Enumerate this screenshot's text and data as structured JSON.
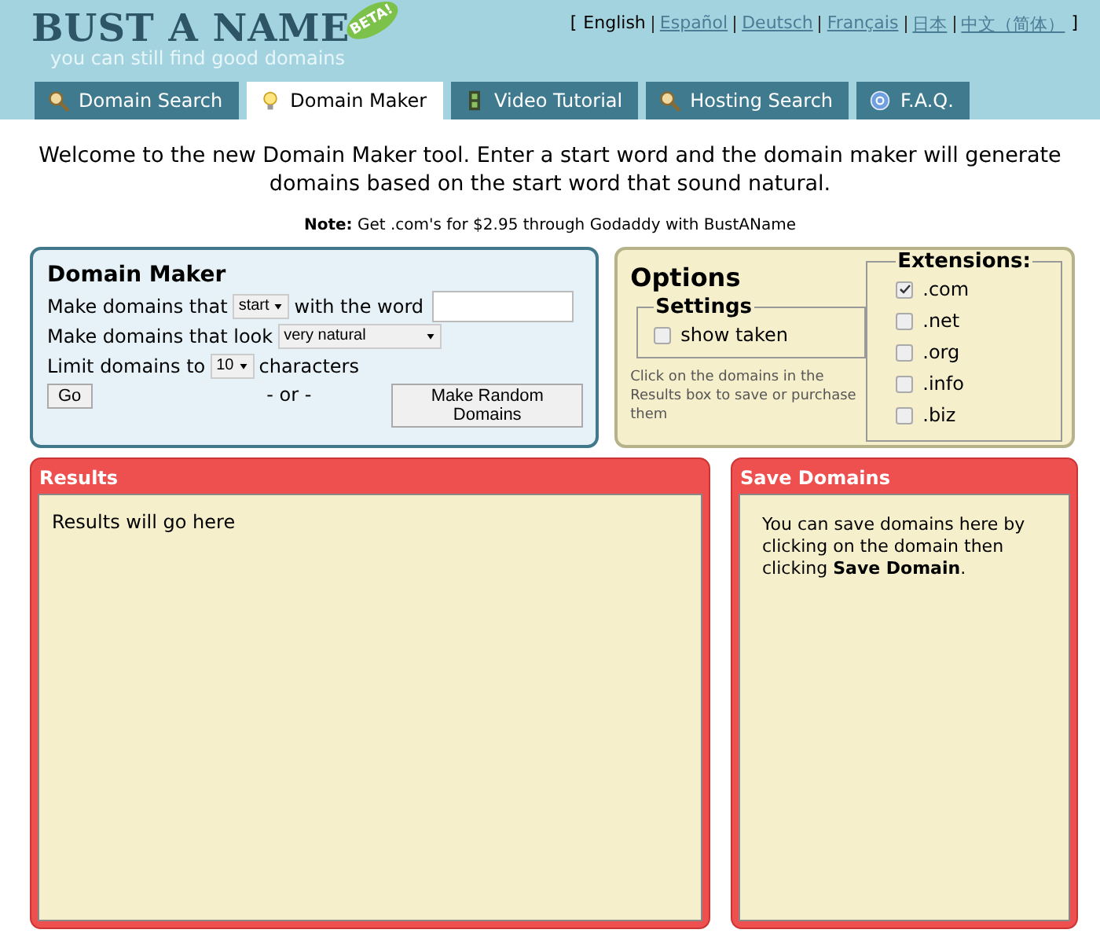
{
  "logo": {
    "title": "BUST A NAME",
    "badge": "BETA!",
    "tagline": "you can still find good domains"
  },
  "language_brackets": {
    "open": "[",
    "close": "]"
  },
  "languages": [
    {
      "label": "English",
      "selected": true
    },
    {
      "label": "Español",
      "selected": false
    },
    {
      "label": "Deutsch",
      "selected": false
    },
    {
      "label": "Français",
      "selected": false
    },
    {
      "label": "日本",
      "selected": false
    },
    {
      "label": "中文（简体）",
      "selected": false
    }
  ],
  "tabs": [
    {
      "label": "Domain Search",
      "kind": "search",
      "selected": false
    },
    {
      "label": "Domain Maker",
      "kind": "maker",
      "selected": true
    },
    {
      "label": "Video Tutorial",
      "kind": "video",
      "selected": false
    },
    {
      "label": "Hosting Search",
      "kind": "search",
      "selected": false
    },
    {
      "label": "F.A.Q.",
      "kind": "faq",
      "selected": false
    }
  ],
  "intro": "Welcome to the new Domain Maker tool. Enter a start word and the domain maker will generate domains based on the start word that sound natural.",
  "note": "**Note:** Get .com's for $2.95 through Godaddy with BustAName",
  "maker": {
    "title": "Domain Maker",
    "row1_before": "Make domains that",
    "position_select": "start",
    "row1_after": "with the word",
    "row2_label": "Make domains that look",
    "style_select": "very natural",
    "row3_before": "Limit domains to",
    "limit_select": "10",
    "row3_after": "characters",
    "go_button": "Go",
    "or_text": "- or -",
    "random_button": "Make Random Domains"
  },
  "options": {
    "title": "Options",
    "settings": {
      "legend": "Settings",
      "items": [
        {
          "label": "show taken",
          "checked": false
        }
      ]
    },
    "hint": "Click on the domains in the Results box to save or purchase them",
    "extensions": {
      "legend": "Extensions:",
      "items": [
        {
          "label": ".com",
          "checked": true
        },
        {
          "label": ".net",
          "checked": false
        },
        {
          "label": ".org",
          "checked": false
        },
        {
          "label": ".info",
          "checked": false
        },
        {
          "label": ".biz",
          "checked": false
        }
      ]
    }
  },
  "results": {
    "title": "Results",
    "text": "Results will go here"
  },
  "save_domains": {
    "title": "Save Domains",
    "text": "You can save domains here by clicking on the domain then clicking **Save Domain**."
  }
}
